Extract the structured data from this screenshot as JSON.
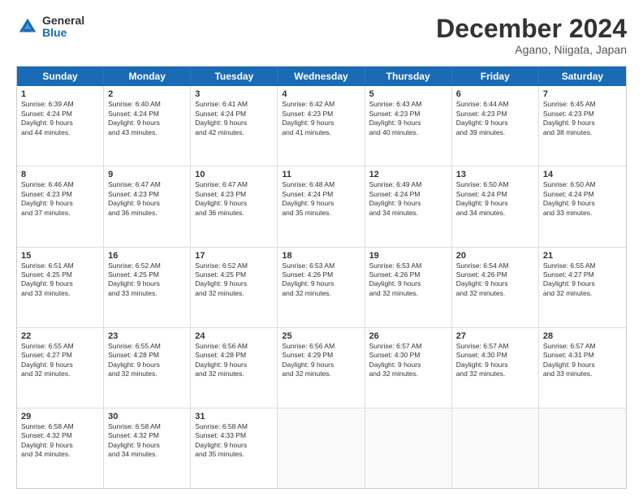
{
  "logo": {
    "general": "General",
    "blue": "Blue"
  },
  "title": "December 2024",
  "subtitle": "Agano, Niigata, Japan",
  "headers": [
    "Sunday",
    "Monday",
    "Tuesday",
    "Wednesday",
    "Thursday",
    "Friday",
    "Saturday"
  ],
  "weeks": [
    [
      {
        "day": "1",
        "info": "Sunrise: 6:39 AM\nSunset: 4:24 PM\nDaylight: 9 hours\nand 44 minutes."
      },
      {
        "day": "2",
        "info": "Sunrise: 6:40 AM\nSunset: 4:24 PM\nDaylight: 9 hours\nand 43 minutes."
      },
      {
        "day": "3",
        "info": "Sunrise: 6:41 AM\nSunset: 4:24 PM\nDaylight: 9 hours\nand 42 minutes."
      },
      {
        "day": "4",
        "info": "Sunrise: 6:42 AM\nSunset: 4:23 PM\nDaylight: 9 hours\nand 41 minutes."
      },
      {
        "day": "5",
        "info": "Sunrise: 6:43 AM\nSunset: 4:23 PM\nDaylight: 9 hours\nand 40 minutes."
      },
      {
        "day": "6",
        "info": "Sunrise: 6:44 AM\nSunset: 4:23 PM\nDaylight: 9 hours\nand 39 minutes."
      },
      {
        "day": "7",
        "info": "Sunrise: 6:45 AM\nSunset: 4:23 PM\nDaylight: 9 hours\nand 38 minutes."
      }
    ],
    [
      {
        "day": "8",
        "info": "Sunrise: 6:46 AM\nSunset: 4:23 PM\nDaylight: 9 hours\nand 37 minutes."
      },
      {
        "day": "9",
        "info": "Sunrise: 6:47 AM\nSunset: 4:23 PM\nDaylight: 9 hours\nand 36 minutes."
      },
      {
        "day": "10",
        "info": "Sunrise: 6:47 AM\nSunset: 4:23 PM\nDaylight: 9 hours\nand 36 minutes."
      },
      {
        "day": "11",
        "info": "Sunrise: 6:48 AM\nSunset: 4:24 PM\nDaylight: 9 hours\nand 35 minutes."
      },
      {
        "day": "12",
        "info": "Sunrise: 6:49 AM\nSunset: 4:24 PM\nDaylight: 9 hours\nand 34 minutes."
      },
      {
        "day": "13",
        "info": "Sunrise: 6:50 AM\nSunset: 4:24 PM\nDaylight: 9 hours\nand 34 minutes."
      },
      {
        "day": "14",
        "info": "Sunrise: 6:50 AM\nSunset: 4:24 PM\nDaylight: 9 hours\nand 33 minutes."
      }
    ],
    [
      {
        "day": "15",
        "info": "Sunrise: 6:51 AM\nSunset: 4:25 PM\nDaylight: 9 hours\nand 33 minutes."
      },
      {
        "day": "16",
        "info": "Sunrise: 6:52 AM\nSunset: 4:25 PM\nDaylight: 9 hours\nand 33 minutes."
      },
      {
        "day": "17",
        "info": "Sunrise: 6:52 AM\nSunset: 4:25 PM\nDaylight: 9 hours\nand 32 minutes."
      },
      {
        "day": "18",
        "info": "Sunrise: 6:53 AM\nSunset: 4:26 PM\nDaylight: 9 hours\nand 32 minutes."
      },
      {
        "day": "19",
        "info": "Sunrise: 6:53 AM\nSunset: 4:26 PM\nDaylight: 9 hours\nand 32 minutes."
      },
      {
        "day": "20",
        "info": "Sunrise: 6:54 AM\nSunset: 4:26 PM\nDaylight: 9 hours\nand 32 minutes."
      },
      {
        "day": "21",
        "info": "Sunrise: 6:55 AM\nSunset: 4:27 PM\nDaylight: 9 hours\nand 32 minutes."
      }
    ],
    [
      {
        "day": "22",
        "info": "Sunrise: 6:55 AM\nSunset: 4:27 PM\nDaylight: 9 hours\nand 32 minutes."
      },
      {
        "day": "23",
        "info": "Sunrise: 6:55 AM\nSunset: 4:28 PM\nDaylight: 9 hours\nand 32 minutes."
      },
      {
        "day": "24",
        "info": "Sunrise: 6:56 AM\nSunset: 4:28 PM\nDaylight: 9 hours\nand 32 minutes."
      },
      {
        "day": "25",
        "info": "Sunrise: 6:56 AM\nSunset: 4:29 PM\nDaylight: 9 hours\nand 32 minutes."
      },
      {
        "day": "26",
        "info": "Sunrise: 6:57 AM\nSunset: 4:30 PM\nDaylight: 9 hours\nand 32 minutes."
      },
      {
        "day": "27",
        "info": "Sunrise: 6:57 AM\nSunset: 4:30 PM\nDaylight: 9 hours\nand 32 minutes."
      },
      {
        "day": "28",
        "info": "Sunrise: 6:57 AM\nSunset: 4:31 PM\nDaylight: 9 hours\nand 33 minutes."
      }
    ],
    [
      {
        "day": "29",
        "info": "Sunrise: 6:58 AM\nSunset: 4:32 PM\nDaylight: 9 hours\nand 34 minutes."
      },
      {
        "day": "30",
        "info": "Sunrise: 6:58 AM\nSunset: 4:32 PM\nDaylight: 9 hours\nand 34 minutes."
      },
      {
        "day": "31",
        "info": "Sunrise: 6:58 AM\nSunset: 4:33 PM\nDaylight: 9 hours\nand 35 minutes."
      },
      {
        "day": "",
        "info": ""
      },
      {
        "day": "",
        "info": ""
      },
      {
        "day": "",
        "info": ""
      },
      {
        "day": "",
        "info": ""
      }
    ]
  ]
}
